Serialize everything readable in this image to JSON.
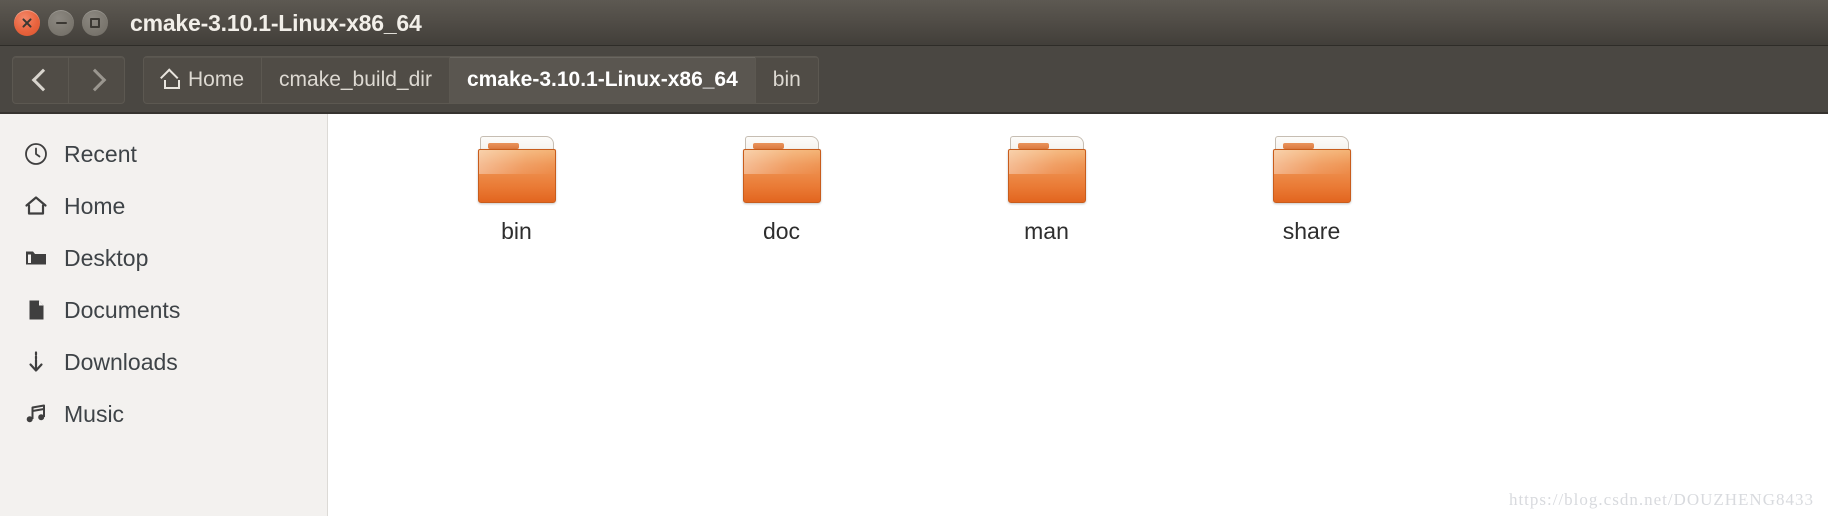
{
  "titlebar": {
    "title": "cmake-3.10.1-Linux-x86_64",
    "controls": [
      {
        "name": "close",
        "label": "Close",
        "color": "#e8633d"
      },
      {
        "name": "minimize",
        "label": "Minimize",
        "color": "#7b776f"
      },
      {
        "name": "maximize",
        "label": "Maximize",
        "color": "#7b776f"
      }
    ]
  },
  "toolbar": {
    "back_label": "Back",
    "forward_label": "Forward",
    "breadcrumbs": [
      {
        "label": "Home",
        "icon": "home-icon",
        "active": false
      },
      {
        "label": "cmake_build_dir",
        "icon": "",
        "active": false
      },
      {
        "label": "cmake-3.10.1-Linux-x86_64",
        "icon": "",
        "active": true
      },
      {
        "label": "bin",
        "icon": "",
        "active": false
      }
    ]
  },
  "sidebar": {
    "items": [
      {
        "label": "Recent",
        "icon": "clock-icon"
      },
      {
        "label": "Home",
        "icon": "house-icon"
      },
      {
        "label": "Desktop",
        "icon": "folder-icon"
      },
      {
        "label": "Documents",
        "icon": "document-icon"
      },
      {
        "label": "Downloads",
        "icon": "download-arrow-icon"
      },
      {
        "label": "Music",
        "icon": "music-note-icon"
      }
    ]
  },
  "content": {
    "files": [
      {
        "label": "bin",
        "type": "folder"
      },
      {
        "label": "doc",
        "type": "folder"
      },
      {
        "label": "man",
        "type": "folder"
      },
      {
        "label": "share",
        "type": "folder"
      }
    ]
  },
  "watermark": {
    "text": "https://blog.csdn.net/DOUZHENG8433"
  },
  "colors": {
    "titlebar_top": "#5d5952",
    "titlebar_bottom": "#413e39",
    "toolbar": "#4a4742",
    "sidebar": "#f3f1ef",
    "content": "#ffffff",
    "folder_orange": "#ea7b36",
    "close_button": "#e8633d"
  }
}
